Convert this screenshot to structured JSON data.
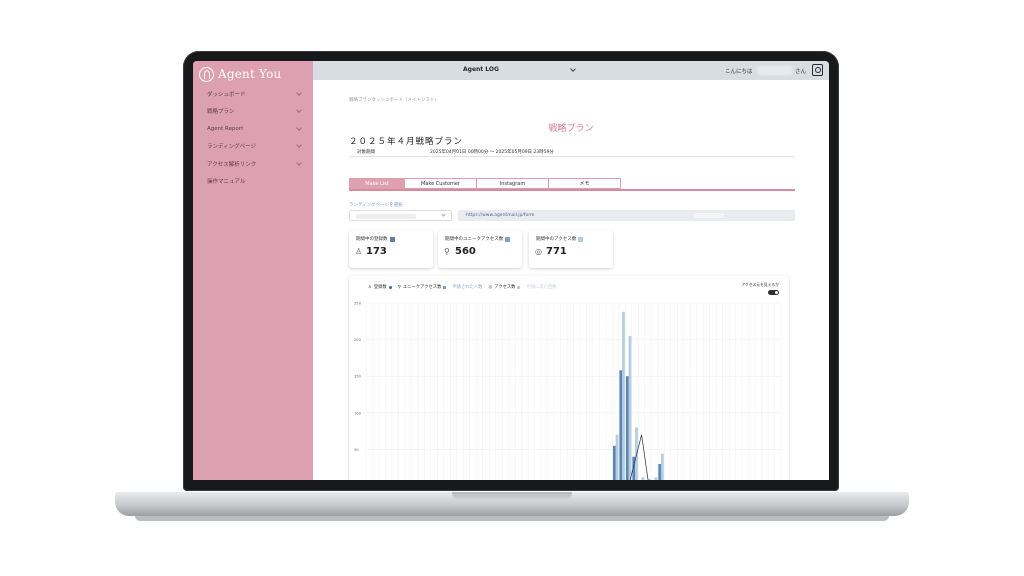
{
  "app": {
    "logo": "Agent You",
    "selector": "Agent LOG",
    "greeting": "こんにちは",
    "greeting_suffix": "さん"
  },
  "sidebar": {
    "items": [
      {
        "label": "ダッシュボード"
      },
      {
        "label": "戦略プラン"
      },
      {
        "label": "Agent Report"
      },
      {
        "label": "ランディングページ"
      },
      {
        "label": "アクセス解析リンク"
      },
      {
        "label": "操作マニュアル"
      }
    ]
  },
  "main": {
    "breadcrumb": "戦略ブランダッシュボード（メイトリスト）",
    "section_title": "戦略プラン",
    "plan_title": "２０２５年４月戦略プラン",
    "period_label": "対象期間",
    "period_value": "2025年04月01日 00時00分 〜 2025年05月09日 23時59分",
    "tabs": [
      {
        "label": "Make List",
        "active": true
      },
      {
        "label": "Make Customer",
        "active": false
      },
      {
        "label": "Instagram",
        "active": false
      },
      {
        "label": "メモ",
        "active": false
      }
    ],
    "lp_label": "ランディングページを選択",
    "url": "https://www.agentmail.jp/form",
    "stats": [
      {
        "label": "期間中の登録数",
        "value": "173",
        "color": "#5b7fa6",
        "icon": "person-icon"
      },
      {
        "label": "期間中のユニークアクセス数",
        "value": "560",
        "color": "#7ea3c8",
        "icon": "unique-icon"
      },
      {
        "label": "期間中のアクセス数",
        "value": "771",
        "color": "#b6cde0",
        "icon": "eye-icon"
      }
    ]
  },
  "chart_data": {
    "type": "bar",
    "legend": [
      "登録数",
      "ユニークアクセス数",
      "申請された人数",
      "アクセス数",
      "申請に来た回数"
    ],
    "toggle_label": "アクセス元を見えるか",
    "y_ticks": [
      "250",
      "200",
      "150",
      "100",
      "50"
    ],
    "ylim": [
      0,
      250
    ],
    "colors": {
      "registrations": "#3d6b9b",
      "unique": "#7ea3c8",
      "access": "#b6cde0"
    },
    "series": [
      {
        "name": "登録数",
        "type": "line",
        "values": [
          0,
          0,
          0,
          0,
          0,
          0,
          0,
          0,
          0,
          0,
          0,
          0,
          0,
          0,
          0,
          0,
          0,
          0,
          0,
          0,
          0,
          0,
          0,
          0,
          0,
          0,
          0,
          0,
          0,
          0,
          0,
          0,
          0,
          0,
          0,
          0,
          0,
          0,
          0,
          0,
          0,
          35,
          70,
          8,
          0,
          0,
          0,
          0,
          0,
          0,
          0,
          0,
          0,
          0,
          0,
          0,
          0,
          0,
          0,
          0,
          0,
          0,
          0,
          0
        ]
      },
      {
        "name": "ユニークアクセス数",
        "values": [
          0,
          0,
          0,
          0,
          0,
          0,
          0,
          0,
          0,
          0,
          0,
          0,
          0,
          0,
          0,
          0,
          0,
          0,
          0,
          0,
          0,
          0,
          0,
          0,
          0,
          0,
          0,
          0,
          0,
          0,
          0,
          0,
          0,
          0,
          0,
          0,
          0,
          0,
          55,
          158,
          150,
          40,
          8,
          6,
          8,
          30,
          0,
          0,
          0,
          0,
          0,
          0,
          0,
          0,
          0,
          0,
          0,
          0,
          0,
          0,
          0,
          0,
          0,
          0
        ]
      },
      {
        "name": "アクセス数",
        "values": [
          0,
          0,
          0,
          0,
          0,
          0,
          0,
          0,
          0,
          0,
          0,
          0,
          0,
          0,
          0,
          0,
          0,
          0,
          0,
          0,
          0,
          0,
          0,
          0,
          0,
          0,
          0,
          0,
          0,
          0,
          0,
          0,
          0,
          0,
          0,
          0,
          0,
          0,
          70,
          238,
          205,
          80,
          12,
          10,
          12,
          44,
          0,
          0,
          0,
          0,
          0,
          0,
          0,
          0,
          0,
          0,
          0,
          0,
          0,
          0,
          0,
          0,
          0,
          0
        ]
      }
    ]
  }
}
